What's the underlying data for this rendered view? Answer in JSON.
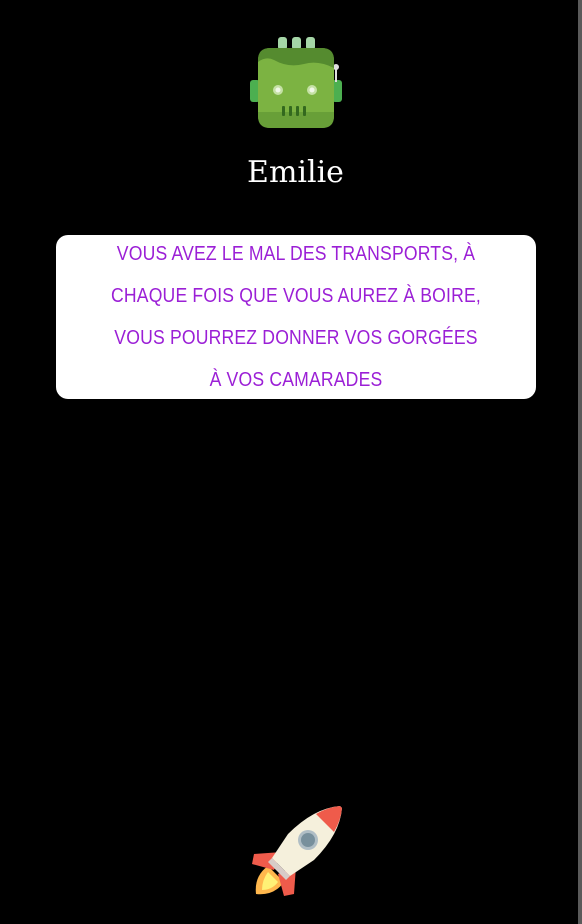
{
  "player": {
    "name": "Emilie",
    "avatar_icon": "robot-head-icon"
  },
  "card": {
    "text": "VOUS AVEZ LE MAL DES TRANSPORTS, À CHAQUE FOIS QUE VOUS AUREZ À BOIRE, VOUS POURREZ DONNER VOS GORGÉES À VOS CAMARADES",
    "text_color": "#9b1fd6",
    "background_color": "#ffffff"
  },
  "next_button": {
    "icon": "rocket-icon"
  },
  "colors": {
    "background": "#000000",
    "robot_green": "#7cb342",
    "rocket_red": "#ef5b4b"
  }
}
